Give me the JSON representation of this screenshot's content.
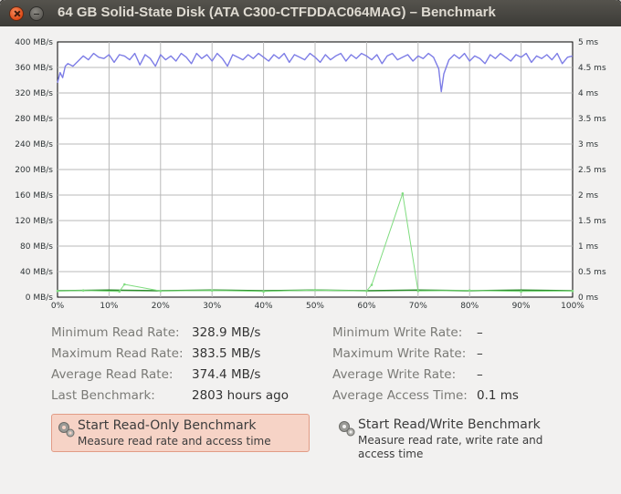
{
  "window": {
    "title": "64 GB Solid-State Disk (ATA C300-CTFDDAC064MAG) – Benchmark"
  },
  "chart_data": {
    "type": "line",
    "x_ticks": [
      "0%",
      "10%",
      "20%",
      "30%",
      "40%",
      "50%",
      "60%",
      "70%",
      "80%",
      "90%",
      "100%"
    ],
    "y_left_ticks": [
      "0 MB/s",
      "40 MB/s",
      "80 MB/s",
      "120 MB/s",
      "160 MB/s",
      "200 MB/s",
      "240 MB/s",
      "280 MB/s",
      "320 MB/s",
      "360 MB/s",
      "400 MB/s"
    ],
    "y_right_ticks": [
      "0 ms",
      "0.5 ms",
      "1 ms",
      "1.5 ms",
      "2 ms",
      "2.5 ms",
      "3 ms",
      "3.5 ms",
      "4 ms",
      "4.5 ms",
      "5 ms"
    ],
    "xlim": [
      0,
      100
    ],
    "ylim_left": [
      0,
      400
    ],
    "ylim_right": [
      0,
      5
    ],
    "grid": true,
    "series": [
      {
        "color": "#7d7de6",
        "axis": "left",
        "values": [
          [
            0,
            336
          ],
          [
            0.5,
            352
          ],
          [
            1,
            344
          ],
          [
            1.5,
            362
          ],
          [
            2,
            366
          ],
          [
            3,
            362
          ],
          [
            4,
            370
          ],
          [
            5,
            378
          ],
          [
            6,
            372
          ],
          [
            7,
            382
          ],
          [
            8,
            376
          ],
          [
            9,
            374
          ],
          [
            10,
            380
          ],
          [
            11,
            368
          ],
          [
            12,
            380
          ],
          [
            13,
            378
          ],
          [
            14,
            372
          ],
          [
            15,
            382
          ],
          [
            16,
            364
          ],
          [
            17,
            380
          ],
          [
            18,
            374
          ],
          [
            19,
            362
          ],
          [
            20,
            380
          ],
          [
            21,
            372
          ],
          [
            22,
            378
          ],
          [
            23,
            370
          ],
          [
            24,
            382
          ],
          [
            25,
            376
          ],
          [
            26,
            366
          ],
          [
            27,
            382
          ],
          [
            28,
            374
          ],
          [
            29,
            380
          ],
          [
            30,
            370
          ],
          [
            31,
            382
          ],
          [
            32,
            374
          ],
          [
            33,
            362
          ],
          [
            34,
            380
          ],
          [
            35,
            376
          ],
          [
            36,
            372
          ],
          [
            37,
            380
          ],
          [
            38,
            374
          ],
          [
            39,
            382
          ],
          [
            40,
            376
          ],
          [
            41,
            370
          ],
          [
            42,
            380
          ],
          [
            43,
            374
          ],
          [
            44,
            382
          ],
          [
            45,
            368
          ],
          [
            46,
            380
          ],
          [
            47,
            376
          ],
          [
            48,
            372
          ],
          [
            49,
            382
          ],
          [
            50,
            376
          ],
          [
            51,
            368
          ],
          [
            52,
            380
          ],
          [
            53,
            372
          ],
          [
            54,
            378
          ],
          [
            55,
            382
          ],
          [
            56,
            370
          ],
          [
            57,
            380
          ],
          [
            58,
            374
          ],
          [
            59,
            382
          ],
          [
            60,
            378
          ],
          [
            61,
            372
          ],
          [
            62,
            380
          ],
          [
            63,
            366
          ],
          [
            64,
            378
          ],
          [
            65,
            382
          ],
          [
            66,
            372
          ],
          [
            67,
            376
          ],
          [
            68,
            380
          ],
          [
            69,
            370
          ],
          [
            70,
            378
          ],
          [
            71,
            374
          ],
          [
            72,
            382
          ],
          [
            73,
            376
          ],
          [
            74,
            358
          ],
          [
            74.5,
            322
          ],
          [
            75,
            350
          ],
          [
            76,
            372
          ],
          [
            77,
            380
          ],
          [
            78,
            374
          ],
          [
            79,
            382
          ],
          [
            80,
            370
          ],
          [
            81,
            378
          ],
          [
            82,
            374
          ],
          [
            83,
            366
          ],
          [
            84,
            380
          ],
          [
            85,
            374
          ],
          [
            86,
            382
          ],
          [
            87,
            376
          ],
          [
            88,
            370
          ],
          [
            89,
            380
          ],
          [
            90,
            376
          ],
          [
            91,
            382
          ],
          [
            92,
            368
          ],
          [
            93,
            378
          ],
          [
            94,
            374
          ],
          [
            95,
            380
          ],
          [
            96,
            372
          ],
          [
            97,
            382
          ],
          [
            98,
            366
          ],
          [
            99,
            376
          ],
          [
            100,
            378
          ]
        ]
      },
      {
        "color": "#2a8c2a",
        "axis": "left",
        "values": [
          [
            0,
            10
          ],
          [
            10,
            11
          ],
          [
            20,
            10
          ],
          [
            30,
            11
          ],
          [
            40,
            10
          ],
          [
            50,
            11
          ],
          [
            60,
            10
          ],
          [
            70,
            11
          ],
          [
            80,
            10
          ],
          [
            90,
            11
          ],
          [
            100,
            10
          ]
        ]
      },
      {
        "color": "#7fdc7f",
        "axis": "right",
        "values": [
          [
            0,
            0.12
          ],
          [
            5,
            0.13
          ],
          [
            12,
            0.11
          ],
          [
            13,
            0.25
          ],
          [
            20,
            0.12
          ],
          [
            30,
            0.13
          ],
          [
            40,
            0.11
          ],
          [
            50,
            0.14
          ],
          [
            60,
            0.12
          ],
          [
            61,
            0.24
          ],
          [
            67,
            2.03
          ],
          [
            70,
            0.12
          ],
          [
            80,
            0.13
          ],
          [
            90,
            0.11
          ],
          [
            100,
            0.12
          ]
        ]
      }
    ]
  },
  "stats": {
    "min_read_label": "Minimum Read Rate:",
    "min_read_value": "328.9 MB/s",
    "max_read_label": "Maximum Read Rate:",
    "max_read_value": "383.5 MB/s",
    "avg_read_label": "Average Read Rate:",
    "avg_read_value": "374.4 MB/s",
    "last_bench_label": "Last Benchmark:",
    "last_bench_value": "2803 hours ago",
    "min_write_label": "Minimum Write Rate:",
    "min_write_value": "–",
    "max_write_label": "Maximum Write Rate:",
    "max_write_value": "–",
    "avg_write_label": "Average Write Rate:",
    "avg_write_value": "–",
    "avg_access_label": "Average Access Time:",
    "avg_access_value": "0.1 ms"
  },
  "buttons": {
    "read_only_title": "Start Read-Only Benchmark",
    "read_only_sub": "Measure read rate and access time",
    "read_write_title": "Start Read/Write Benchmark",
    "read_write_sub": "Measure read rate, write rate and access time"
  }
}
